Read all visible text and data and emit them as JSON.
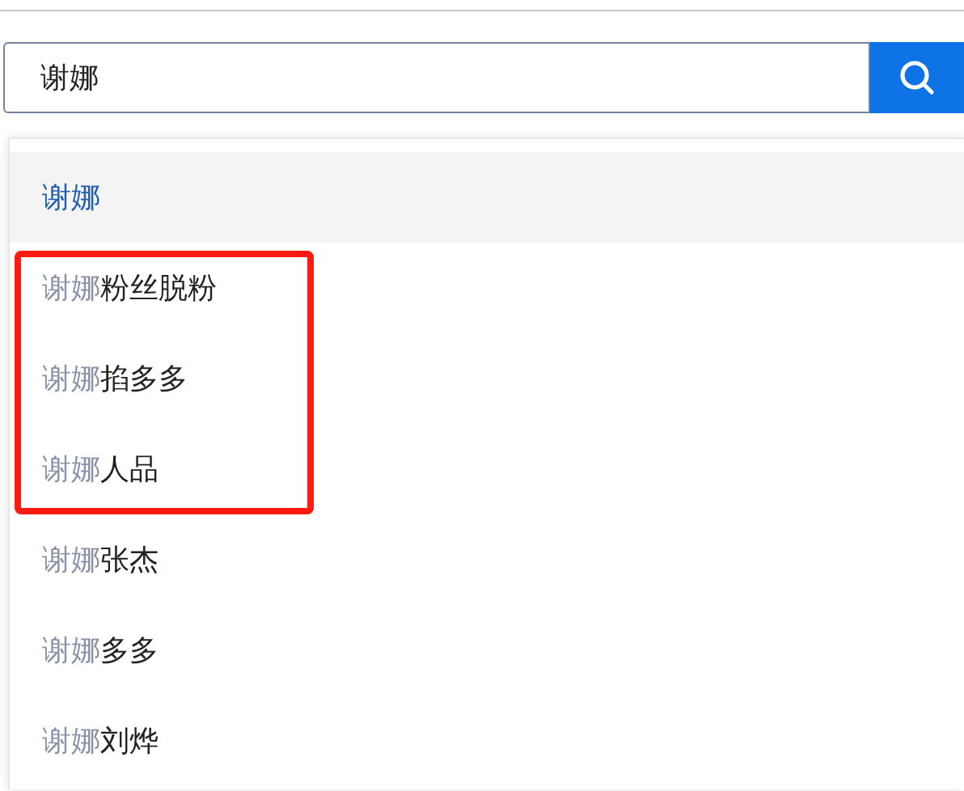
{
  "search": {
    "value": "谢娜",
    "focused": true
  },
  "suggestions": [
    {
      "match": "谢娜",
      "selected": true,
      "boxed": false
    },
    {
      "match": "谢娜",
      "rest": "粉丝脱粉",
      "selected": false,
      "boxed": true
    },
    {
      "match": "谢娜",
      "rest": "掐多多",
      "selected": false,
      "boxed": true
    },
    {
      "match": "谢娜",
      "rest": "人品",
      "selected": false,
      "boxed": true
    },
    {
      "match": "谢娜",
      "rest": "张杰",
      "selected": false,
      "boxed": false
    },
    {
      "match": "谢娜",
      "rest": "多多",
      "selected": false,
      "boxed": false
    },
    {
      "match": "谢娜",
      "rest": "刘烨",
      "selected": false,
      "boxed": false
    }
  ]
}
